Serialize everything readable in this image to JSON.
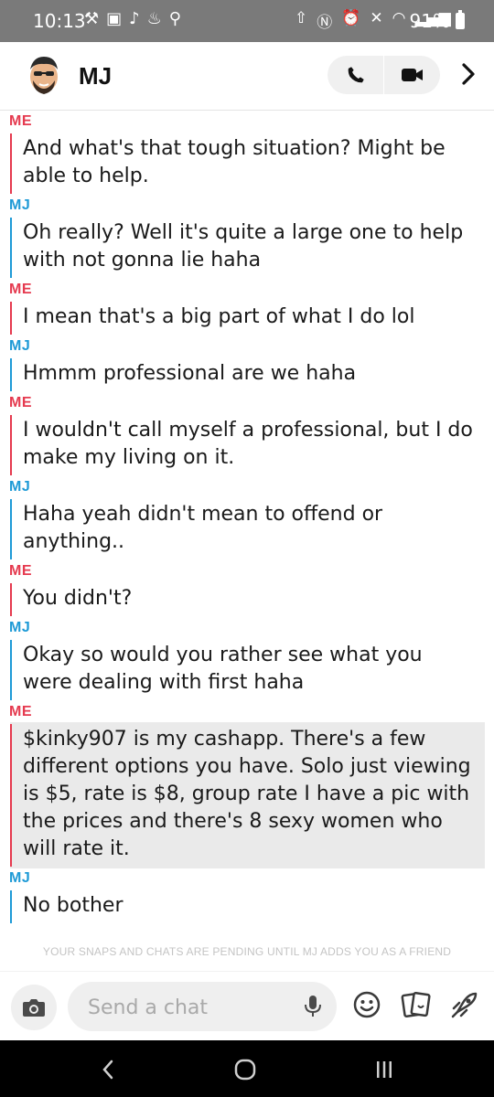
{
  "status_bar": {
    "time": "10:13",
    "battery": "91%",
    "left_icons": [
      "tools-icon",
      "news-icon",
      "tiktok-icon",
      "fire-icon",
      "pin-icon"
    ],
    "right_icons": [
      "upload-icon",
      "nfc-icon",
      "alarm-icon",
      "mute-icon",
      "wifi-icon",
      "signal-icon",
      "battery-icon"
    ]
  },
  "header": {
    "contact_name": "MJ"
  },
  "messages": [
    {
      "sender": "ME",
      "from_me": true,
      "text": "And what's that tough situation? Might be able to help."
    },
    {
      "sender": "MJ",
      "from_me": false,
      "text": "Oh really? Well it's quite a large one to help with not gonna lie haha"
    },
    {
      "sender": "ME",
      "from_me": true,
      "text": "I mean that's a big part of what I do lol"
    },
    {
      "sender": "MJ",
      "from_me": false,
      "text": "Hmmm professional are we haha"
    },
    {
      "sender": "ME",
      "from_me": true,
      "text": "I wouldn't call myself a professional, but I do make my living on it."
    },
    {
      "sender": "MJ",
      "from_me": false,
      "text": "Haha yeah didn't mean to offend or anything.."
    },
    {
      "sender": "ME",
      "from_me": true,
      "text": "You didn't?"
    },
    {
      "sender": "MJ",
      "from_me": false,
      "text": "Okay so would you rather see what you were dealing with first haha"
    },
    {
      "sender": "ME",
      "from_me": true,
      "highlighted": true,
      "text": "$kinky907 is my cashapp. There's a few different options you have. Solo just viewing is $5, rate is $8, group rate I have a pic with the prices and there's 8 sexy women who will rate it."
    },
    {
      "sender": "MJ",
      "from_me": false,
      "text": "No bother"
    }
  ],
  "pending_notice": "YOUR SNAPS AND CHATS ARE PENDING UNTIL MJ ADDS YOU AS A FRIEND",
  "input": {
    "placeholder": "Send a chat",
    "value": ""
  },
  "colors": {
    "me": "#e53a4f",
    "mj": "#1e9ad6",
    "status_bar": "#7a7a7a",
    "nav_bar": "#000000",
    "highlight": "#eaeaea"
  }
}
